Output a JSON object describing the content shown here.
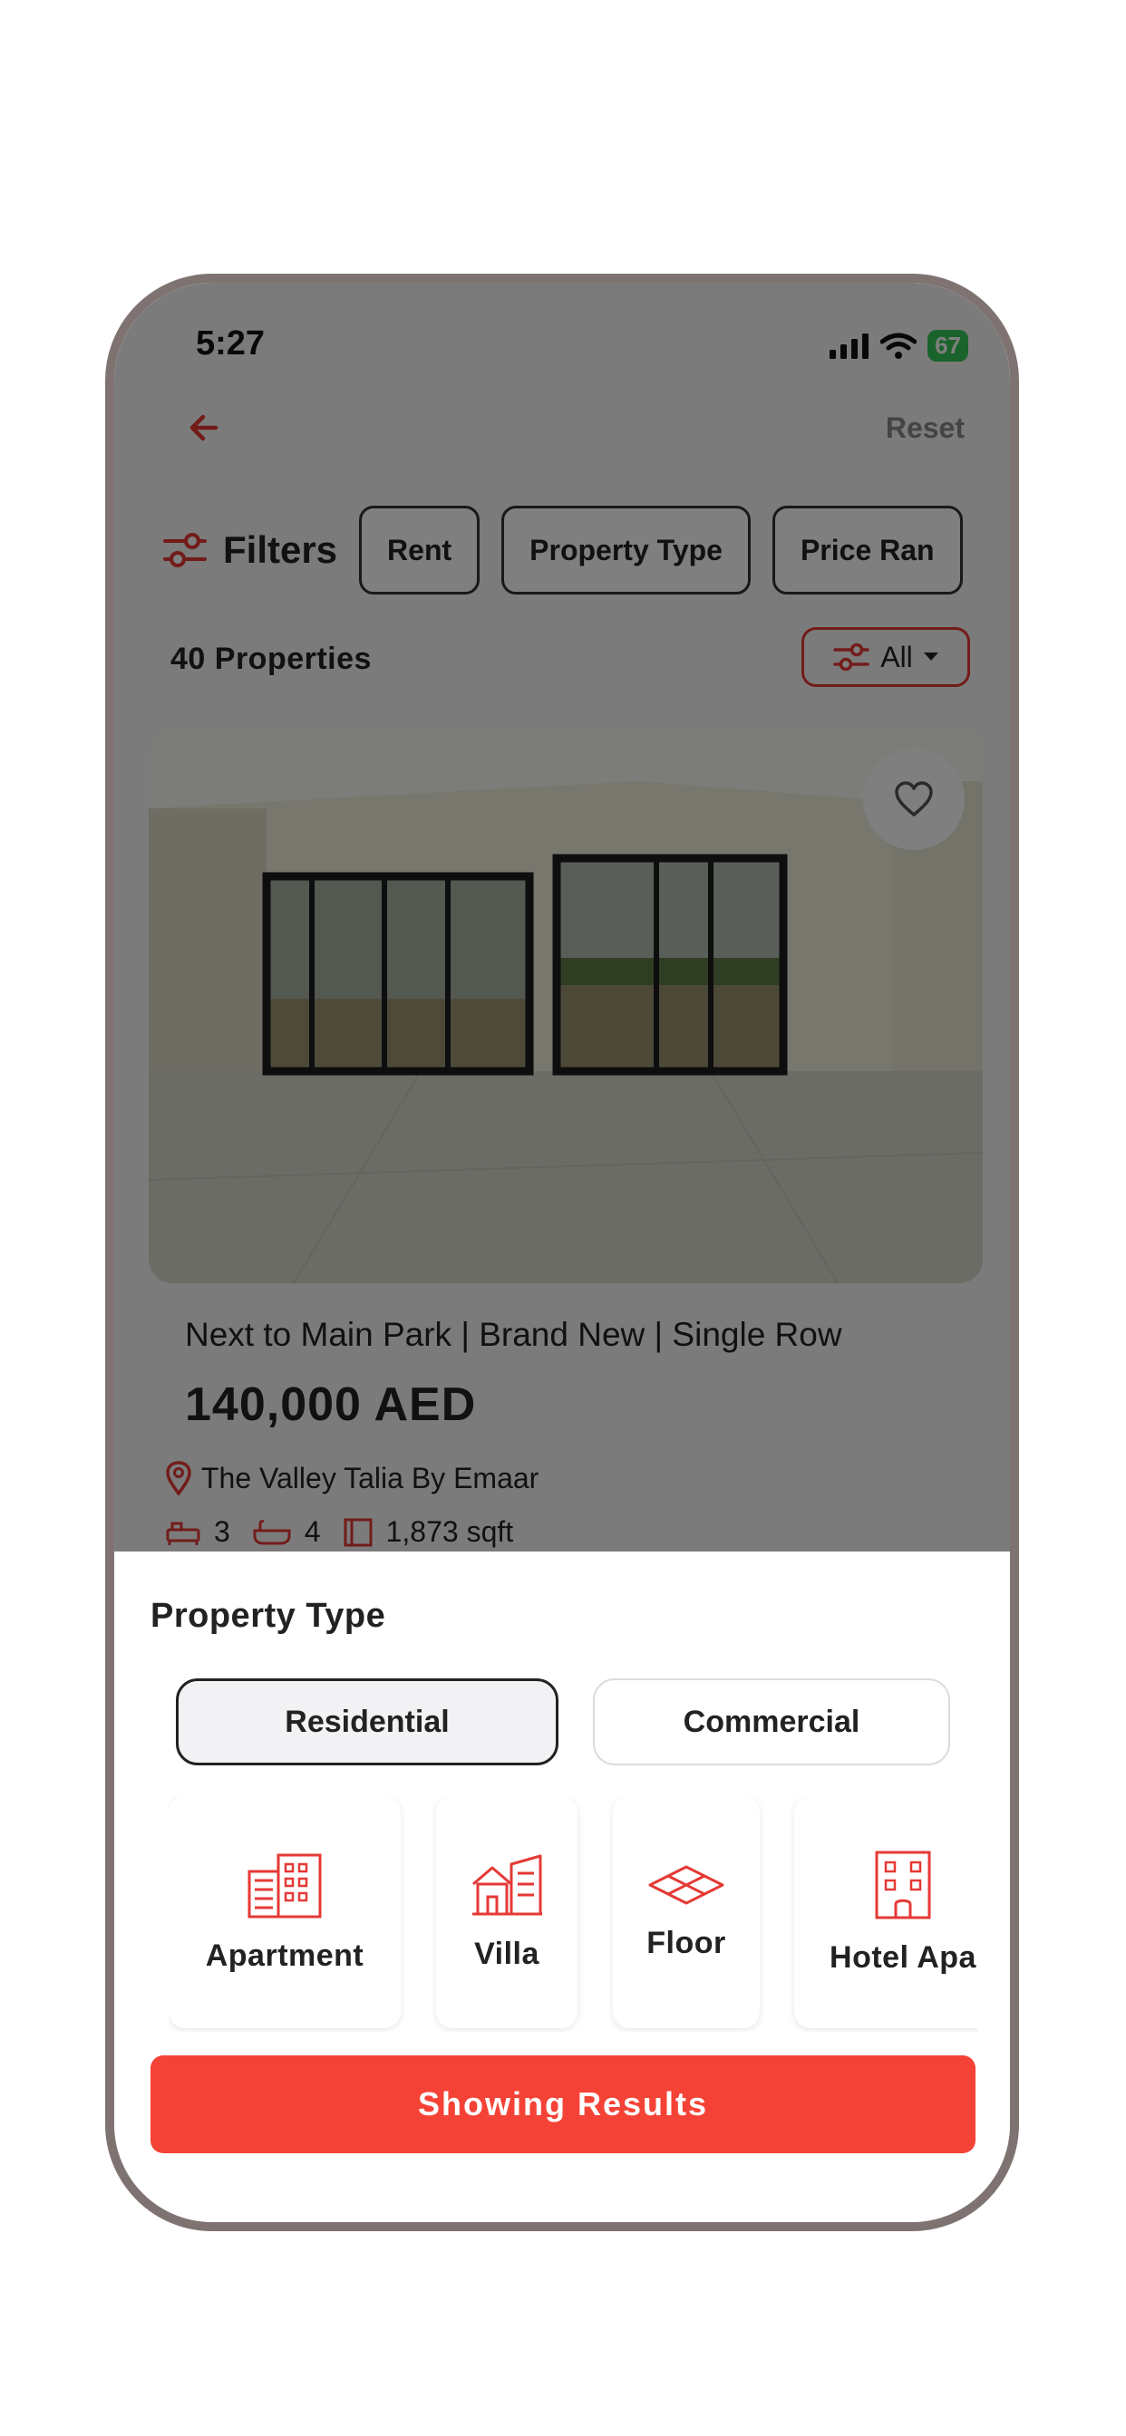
{
  "status": {
    "time": "5:27",
    "battery": "67"
  },
  "header": {
    "reset_label": "Reset"
  },
  "filters": {
    "title": "Filters",
    "chips": [
      "Rent",
      "Property Type",
      "Price Ran"
    ]
  },
  "results": {
    "count_label": "40 Properties",
    "sort_label": "All"
  },
  "listing": {
    "title": "Next to Main Park | Brand New | Single Row",
    "price": "140,000 AED",
    "location": "The Valley Talia By Emaar",
    "beds": "3",
    "baths": "4",
    "area": "1,873 sqft"
  },
  "sheet": {
    "title": "Property Type",
    "segments": [
      "Residential",
      "Commercial"
    ],
    "selected_segment": "Residential",
    "types": [
      {
        "label": "Apartment",
        "icon": "apartment-icon"
      },
      {
        "label": "Villa",
        "icon": "villa-icon"
      },
      {
        "label": "Floor",
        "icon": "floor-icon"
      },
      {
        "label": "Hotel Apa",
        "icon": "hotel-apartment-icon"
      }
    ],
    "button_label": "Showing Results"
  },
  "colors": {
    "accent": "#e53935",
    "button": "#f44336",
    "frame": "#7f7372"
  }
}
